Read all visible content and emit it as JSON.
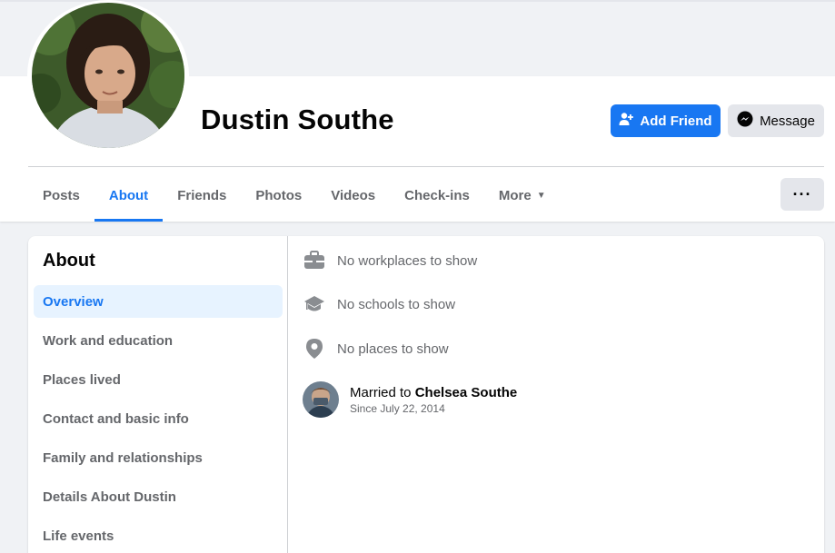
{
  "profile": {
    "name": "Dustin Southe"
  },
  "actions": {
    "add_friend_label": "Add Friend",
    "message_label": "Message",
    "more_options_label": "···"
  },
  "tabs": [
    {
      "label": "Posts",
      "active": false
    },
    {
      "label": "About",
      "active": true
    },
    {
      "label": "Friends",
      "active": false
    },
    {
      "label": "Photos",
      "active": false
    },
    {
      "label": "Videos",
      "active": false
    },
    {
      "label": "Check-ins",
      "active": false
    },
    {
      "label": "More",
      "active": false
    }
  ],
  "about": {
    "title": "About",
    "sidebar_items": [
      {
        "label": "Overview",
        "active": true
      },
      {
        "label": "Work and education",
        "active": false
      },
      {
        "label": "Places lived",
        "active": false
      },
      {
        "label": "Contact and basic info",
        "active": false
      },
      {
        "label": "Family and relationships",
        "active": false
      },
      {
        "label": "Details About Dustin",
        "active": false
      },
      {
        "label": "Life events",
        "active": false
      }
    ],
    "overview": {
      "workplaces": "No workplaces to show",
      "schools": "No schools to show",
      "places": "No places to show",
      "relationship": {
        "prefix": "Married to",
        "partner": "Chelsea Southe",
        "since": "Since July 22, 2014"
      }
    }
  },
  "colors": {
    "accent": "#1877f2",
    "background": "#f0f2f5",
    "secondary_text": "#65676b",
    "active_item_bg": "#e7f3ff"
  },
  "icons": {
    "add_friend": "add-friend-icon",
    "message": "messenger-icon",
    "more_caret": "caret-down-icon",
    "work": "briefcase-icon",
    "school": "graduation-cap-icon",
    "place": "location-pin-icon"
  }
}
